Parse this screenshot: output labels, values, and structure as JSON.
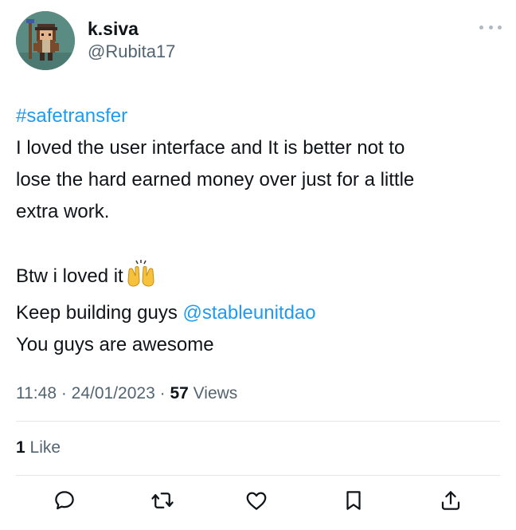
{
  "author": {
    "display_name": "k.siva",
    "handle": "@Rubita17"
  },
  "tweet": {
    "hashtag": "#safetransfer",
    "text_line_1": "I loved the user interface and It is better not to",
    "text_line_2": "lose the hard earned money over just for a little",
    "text_line_3": "extra work.",
    "text_line_4": "Btw i loved it",
    "text_line_4_emoji": "raising-hands-emoji",
    "text_line_5_prefix": "Keep building guys ",
    "mention": "@stableunitdao",
    "text_line_6": "You guys are awesome"
  },
  "meta": {
    "time": "11:48",
    "separator": " · ",
    "date": "24/01/2023",
    "views_count": "57",
    "views_label": " Views"
  },
  "engagement": {
    "likes_count": "1",
    "likes_label": " Like"
  },
  "actions": {
    "reply_icon": "reply-icon",
    "retweet_icon": "retweet-icon",
    "like_icon": "like-icon",
    "bookmark_icon": "bookmark-icon",
    "share_icon": "share-icon"
  },
  "colors": {
    "link": "#1d9bf0",
    "text": "#0f1419",
    "secondary": "#536471",
    "divider": "#e3e7ea"
  }
}
